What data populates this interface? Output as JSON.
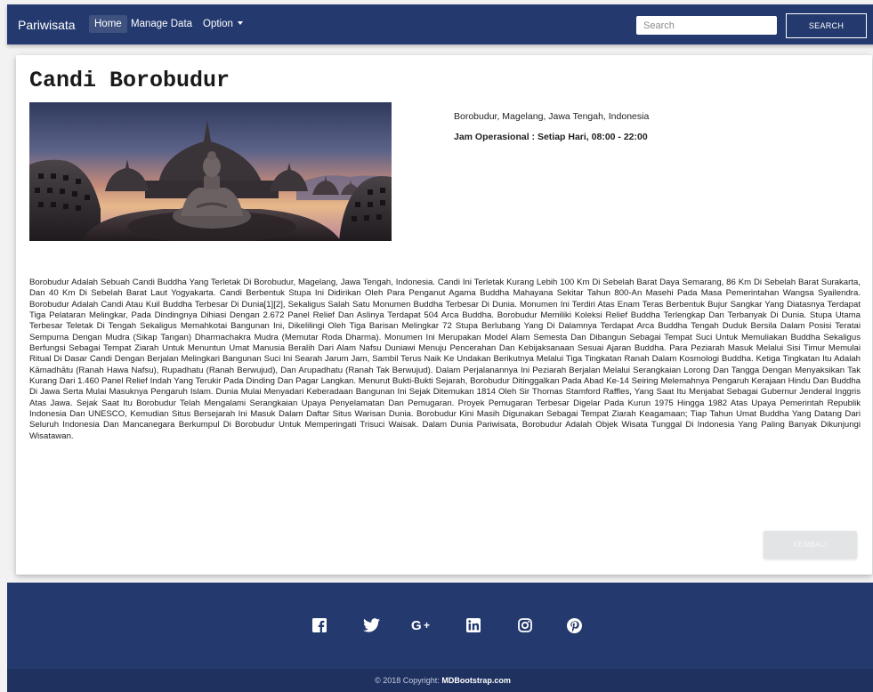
{
  "navbar": {
    "brand": "Pariwisata",
    "links": [
      {
        "label": "Home"
      },
      {
        "label": "Manage Data"
      },
      {
        "label": "Option"
      }
    ],
    "search_placeholder": "Search",
    "search_button": "SEARCH"
  },
  "detail": {
    "title": "Candi Borobudur",
    "location": "Borobudur, Magelang, Jawa Tengah, Indonesia",
    "hours": "Jam Operasional : Setiap Hari, 08:00 - 22:00",
    "photo_alt": "borobudur-stupa-buddha-photo",
    "description": "Borobudur Adalah Sebuah Candi Buddha Yang Terletak Di Borobudur, Magelang, Jawa Tengah, Indonesia. Candi Ini Terletak Kurang Lebih 100 Km Di Sebelah Barat Daya Semarang, 86 Km Di Sebelah Barat Surakarta, Dan 40 Km Di Sebelah Barat Laut Yogyakarta. Candi Berbentuk Stupa Ini Didirikan Oleh Para Penganut Agama Buddha Mahayana Sekitar Tahun 800-An Masehi Pada Masa Pemerintahan Wangsa Syailendra. Borobudur Adalah Candi Atau Kuil Buddha Terbesar Di Dunia[1][2], Sekaligus Salah Satu Monumen Buddha Terbesar Di Dunia. Monumen Ini Terdiri Atas Enam Teras Berbentuk Bujur Sangkar Yang Diatasnya Terdapat Tiga Pelataran Melingkar, Pada Dindingnya Dihiasi Dengan 2.672 Panel Relief Dan Aslinya Terdapat 504 Arca Buddha. Borobudur Memiliki Koleksi Relief Buddha Terlengkap Dan Terbanyak Di Dunia. Stupa Utama Terbesar Teletak Di Tengah Sekaligus Memahkotai Bangunan Ini, Dikelilingi Oleh Tiga Barisan Melingkar 72 Stupa Berlubang Yang Di Dalamnya Terdapat Arca Buddha Tengah Duduk Bersila Dalam Posisi Teratai Sempurna Dengan Mudra (Sikap Tangan) Dharmachakra Mudra (Memutar Roda Dharma). Monumen Ini Merupakan Model Alam Semesta Dan Dibangun Sebagai Tempat Suci Untuk Memuliakan Buddha Sekaligus Berfungsi Sebagai Tempat Ziarah Untuk Menuntun Umat Manusia Beralih Dari Alam Nafsu Duniawi Menuju Pencerahan Dan Kebijaksanaan Sesuai Ajaran Buddha. Para Peziarah Masuk Melalui Sisi Timur Memulai Ritual Di Dasar Candi Dengan Berjalan Melingkari Bangunan Suci Ini Searah Jarum Jam, Sambil Terus Naik Ke Undakan Berikutnya Melalui Tiga Tingkatan Ranah Dalam Kosmologi Buddha. Ketiga Tingkatan Itu Adalah Kāmadhātu (Ranah Hawa Nafsu), Rupadhatu (Ranah Berwujud), Dan Arupadhatu (Ranah Tak Berwujud). Dalam Perjalanannya Ini Peziarah Berjalan Melalui Serangkaian Lorong Dan Tangga Dengan Menyaksikan Tak Kurang Dari 1.460 Panel Relief Indah Yang Terukir Pada Dinding Dan Pagar Langkan. Menurut Bukti-Bukti Sejarah, Borobudur Ditinggalkan Pada Abad Ke-14 Seiring Melemahnya Pengaruh Kerajaan Hindu Dan Buddha Di Jawa Serta Mulai Masuknya Pengaruh Islam. Dunia Mulai Menyadari Keberadaan Bangunan Ini Sejak Ditemukan 1814 Oleh Sir Thomas Stamford Raffles, Yang Saat Itu Menjabat Sebagai Gubernur Jenderal Inggris Atas Jawa. Sejak Saat Itu Borobudur Telah Mengalami Serangkaian Upaya Penyelamatan Dan Pemugaran. Proyek Pemugaran Terbesar Digelar Pada Kurun 1975 Hingga 1982 Atas Upaya Pemerintah Republik Indonesia Dan UNESCO, Kemudian Situs Bersejarah Ini Masuk Dalam Daftar Situs Warisan Dunia. Borobudur Kini Masih Digunakan Sebagai Tempat Ziarah Keagamaan; Tiap Tahun Umat Buddha Yang Datang Dari Seluruh Indonesia Dan Mancanegara Berkumpul Di Borobudur Untuk Memperingati Trisuci Waisak. Dalam Dunia Pariwisata, Borobudur Adalah Objek Wisata Tunggal Di Indonesia Yang Paling Banyak Dikunjungi Wisatawan.",
    "back_button": "KEMBALI"
  },
  "footer": {
    "social_icons": [
      "facebook-icon",
      "twitter-icon",
      "google-plus-icon",
      "linkedin-icon",
      "instagram-icon",
      "pinterest-icon"
    ],
    "copyright_prefix": "© 2018 Copyright: ",
    "copyright_brand": "MDBootstrap.com"
  },
  "colors": {
    "navbar": "#243a6e",
    "footer": "#243a6e",
    "copyright_bar": "#1f315f",
    "page_bg": "#f2f2f2",
    "button_disabled": "#e3e4e6"
  }
}
